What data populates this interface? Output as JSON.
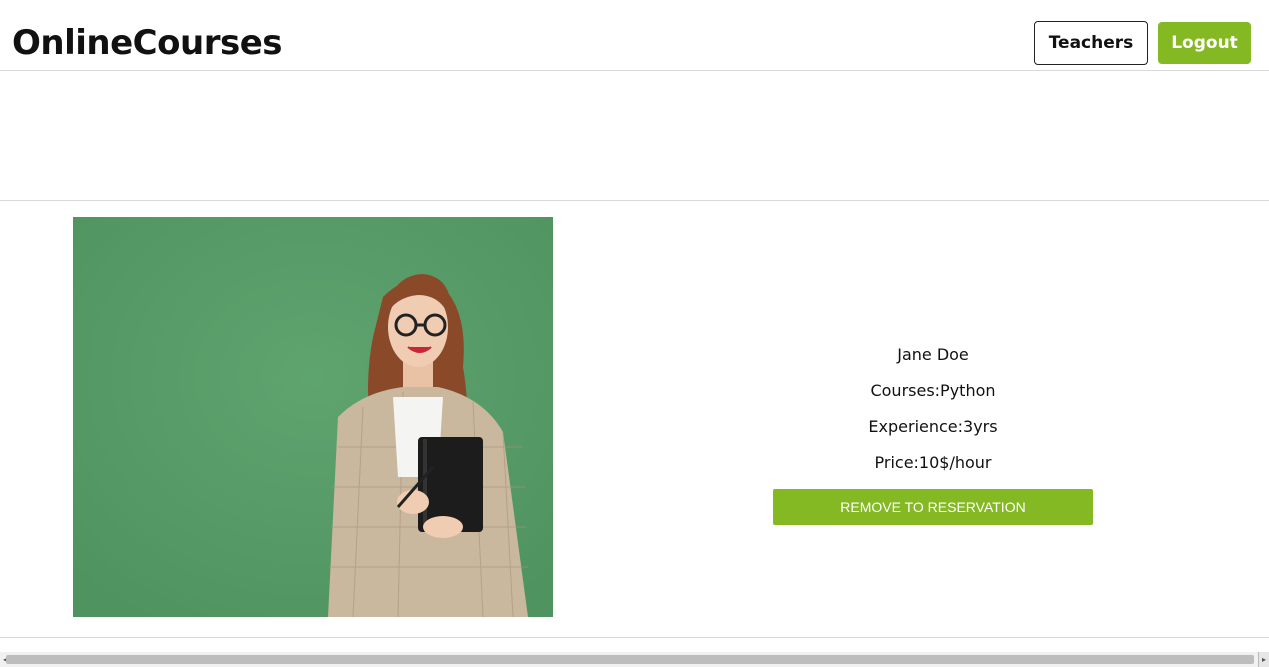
{
  "header": {
    "brand": "OnlineCourses",
    "teachers_label": "Teachers",
    "logout_label": "Logout"
  },
  "teacher": {
    "name": "Jane Doe",
    "courses": "Courses:Python",
    "experience": "Experience:3yrs",
    "price": "Price:10$/hour",
    "action_label": "REMOVE TO RESERVATION"
  },
  "colors": {
    "accent": "#84b923",
    "photo_background": "#5a9a68"
  },
  "icons": {
    "scroll_left": "triangle-left",
    "scroll_right": "triangle-right"
  }
}
